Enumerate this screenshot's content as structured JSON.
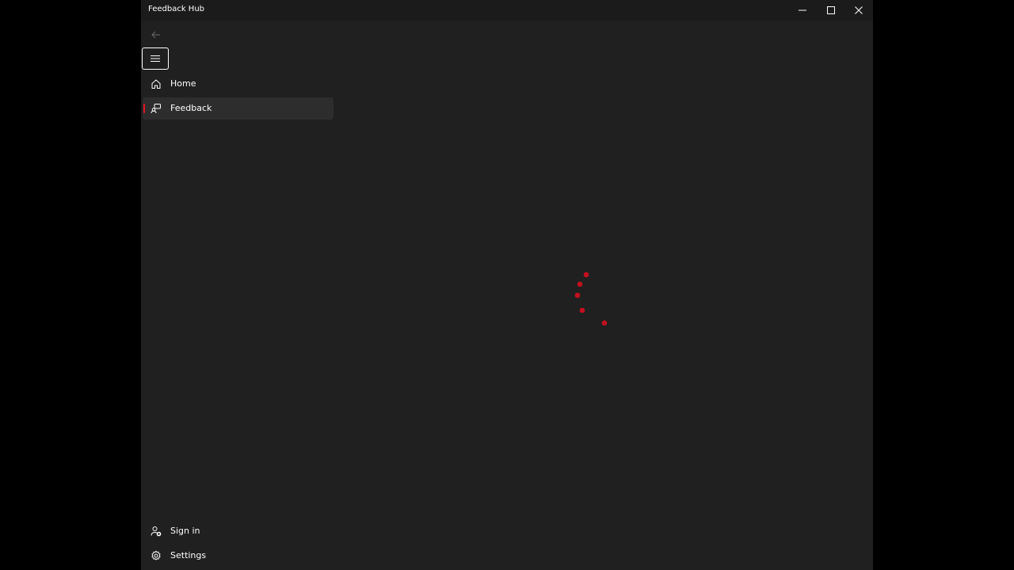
{
  "window": {
    "title": "Feedback Hub"
  },
  "nav": {
    "items": [
      {
        "label": "Home",
        "icon": "home-icon"
      },
      {
        "label": "Feedback",
        "icon": "feedback-icon",
        "selected": true
      }
    ],
    "footer_items": [
      {
        "label": "Sign in",
        "icon": "person-add-icon"
      },
      {
        "label": "Settings",
        "icon": "gear-icon"
      }
    ]
  },
  "colors": {
    "accent": "#e81123",
    "spinner": "#c50f1f",
    "background": "#202020",
    "titlebar": "#1b1b1b",
    "selected_item": "#2d2d2d"
  },
  "loading": {
    "indicator": "progress-ring",
    "active": true
  }
}
